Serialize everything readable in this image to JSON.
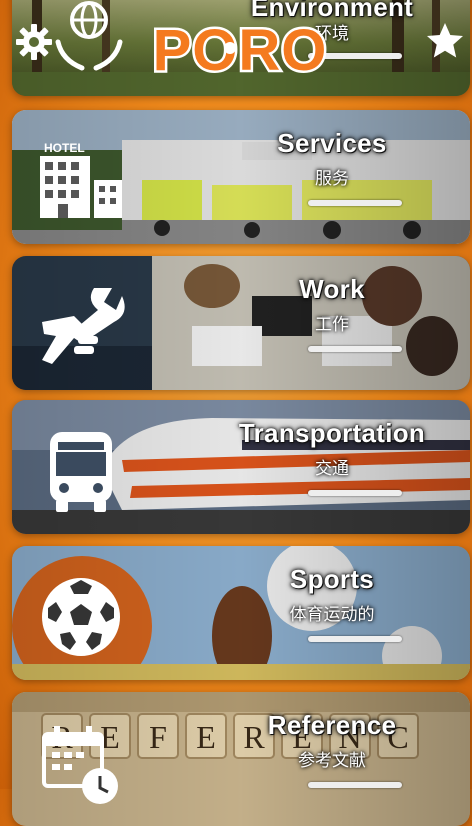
{
  "app": {
    "logo_text": "PORO"
  },
  "categories": [
    {
      "title": "Environment",
      "subtitle": "环境"
    },
    {
      "title": "Services",
      "subtitle": "服务"
    },
    {
      "title": "Work",
      "subtitle": "工作"
    },
    {
      "title": "Transportation",
      "subtitle": "交通"
    },
    {
      "title": "Sports",
      "subtitle": "体育运动的"
    },
    {
      "title": "Reference",
      "subtitle": "参考文献"
    }
  ],
  "colors": {
    "brand_orange": "#f47a1f",
    "accent": "#f7a53a"
  }
}
